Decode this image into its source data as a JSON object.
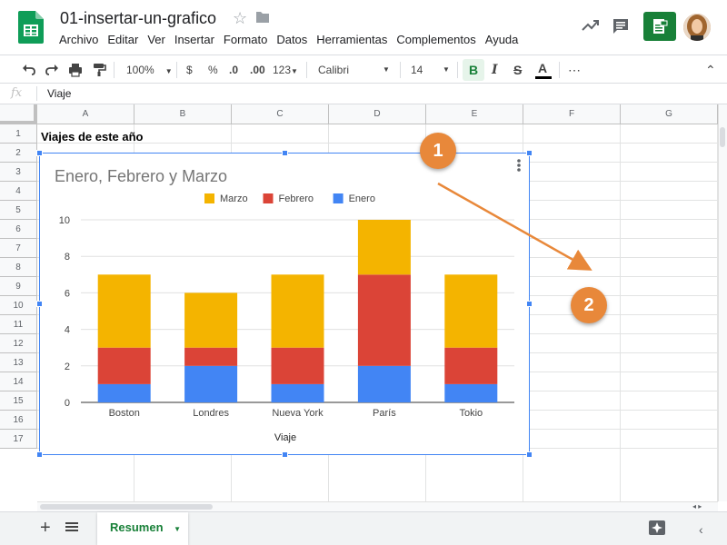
{
  "app": {
    "doc_title": "01-insertar-un-grafico",
    "menu": [
      "Archivo",
      "Editar",
      "Ver",
      "Insertar",
      "Formato",
      "Datos",
      "Herramientas",
      "Complementos",
      "Ayuda"
    ]
  },
  "toolbar": {
    "zoom": "100%",
    "currency": "$",
    "percent": "%",
    "dec_decrease": ".0",
    "dec_increase": ".00",
    "more_formats": "123",
    "font": "Calibri",
    "font_size": "14",
    "bold": "B",
    "italic": "I",
    "strike": "S",
    "text_color": "A",
    "more": "⋯",
    "collapse": "⌃"
  },
  "formula_bar": {
    "fx": "fx",
    "value": "Viaje"
  },
  "grid": {
    "columns": [
      "A",
      "B",
      "C",
      "D",
      "E",
      "F",
      "G"
    ],
    "rows": [
      "1",
      "2",
      "3",
      "4",
      "5",
      "6",
      "7",
      "8",
      "9",
      "10",
      "11",
      "12",
      "13",
      "14",
      "15",
      "16",
      "17"
    ],
    "cell_a1": "Viajes de este año"
  },
  "chart_data": {
    "type": "bar",
    "stacked": true,
    "title": "Enero, Febrero y Marzo",
    "xlabel": "Viaje",
    "ylabel": "",
    "categories": [
      "Boston",
      "Londres",
      "Nueva York",
      "París",
      "Tokio"
    ],
    "series": [
      {
        "name": "Enero",
        "values": [
          1,
          2,
          1,
          2,
          1
        ],
        "color": "#4285f4"
      },
      {
        "name": "Febrero",
        "values": [
          2,
          1,
          2,
          5,
          2
        ],
        "color": "#db4437"
      },
      {
        "name": "Marzo",
        "values": [
          4,
          3,
          4,
          3,
          4
        ],
        "color": "#f4b400"
      }
    ],
    "legend_order": [
      "Marzo",
      "Febrero",
      "Enero"
    ],
    "legend_position": "top",
    "ylim": [
      0,
      10
    ],
    "yticks": [
      "0",
      "2",
      "4",
      "6",
      "8",
      "10"
    ],
    "grid": true
  },
  "callouts": [
    "1",
    "2"
  ],
  "sheets": {
    "active": "Resumen"
  },
  "colors": {
    "accent_green": "#188038",
    "selection_blue": "#4285f4",
    "callout_orange": "#e8883a"
  }
}
